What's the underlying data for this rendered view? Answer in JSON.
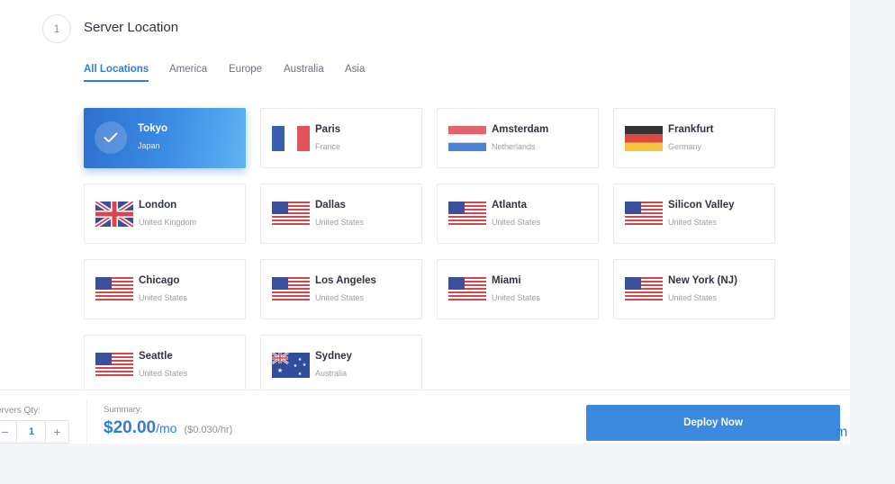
{
  "section": {
    "step_number": "1",
    "title": "Server Location"
  },
  "tabs": [
    {
      "label": "All Locations",
      "active": true
    },
    {
      "label": "America",
      "active": false
    },
    {
      "label": "Europe",
      "active": false
    },
    {
      "label": "Australia",
      "active": false
    },
    {
      "label": "Asia",
      "active": false
    }
  ],
  "locations": [
    {
      "city": "Tokyo",
      "country": "Japan",
      "selected": true,
      "flag": "check-icon"
    },
    {
      "city": "Paris",
      "country": "France",
      "selected": false,
      "flag": "france-flag-icon"
    },
    {
      "city": "Amsterdam",
      "country": "Netherlands",
      "selected": false,
      "flag": "netherlands-flag-icon"
    },
    {
      "city": "Frankfurt",
      "country": "Germany",
      "selected": false,
      "flag": "germany-flag-icon"
    },
    {
      "city": "London",
      "country": "United Kingdom",
      "selected": false,
      "flag": "uk-flag-icon"
    },
    {
      "city": "Dallas",
      "country": "United States",
      "selected": false,
      "flag": "us-flag-icon"
    },
    {
      "city": "Atlanta",
      "country": "United States",
      "selected": false,
      "flag": "us-flag-icon"
    },
    {
      "city": "Silicon Valley",
      "country": "United States",
      "selected": false,
      "flag": "us-flag-icon"
    },
    {
      "city": "Chicago",
      "country": "United States",
      "selected": false,
      "flag": "us-flag-icon"
    },
    {
      "city": "Los Angeles",
      "country": "United States",
      "selected": false,
      "flag": "us-flag-icon"
    },
    {
      "city": "Miami",
      "country": "United States",
      "selected": false,
      "flag": "us-flag-icon"
    },
    {
      "city": "New York (NJ)",
      "country": "United States",
      "selected": false,
      "flag": "us-flag-icon"
    },
    {
      "city": "Seattle",
      "country": "United States",
      "selected": false,
      "flag": "us-flag-icon"
    },
    {
      "city": "Sydney",
      "country": "Australia",
      "selected": false,
      "flag": "australia-flag-icon"
    }
  ],
  "footer": {
    "qty_label": "ervers Qty:",
    "qty_value": "1",
    "minus": "−",
    "plus": "+",
    "summary_label": "Summary:",
    "price": "$20.00",
    "price_unit": "/mo",
    "hourly": "($0.030/hr)",
    "deploy_label": "Deploy Now",
    "edge_fragment": "m"
  },
  "colors": {
    "accent": "#2f7dd6",
    "deploy_button": "#3c8ae0"
  }
}
